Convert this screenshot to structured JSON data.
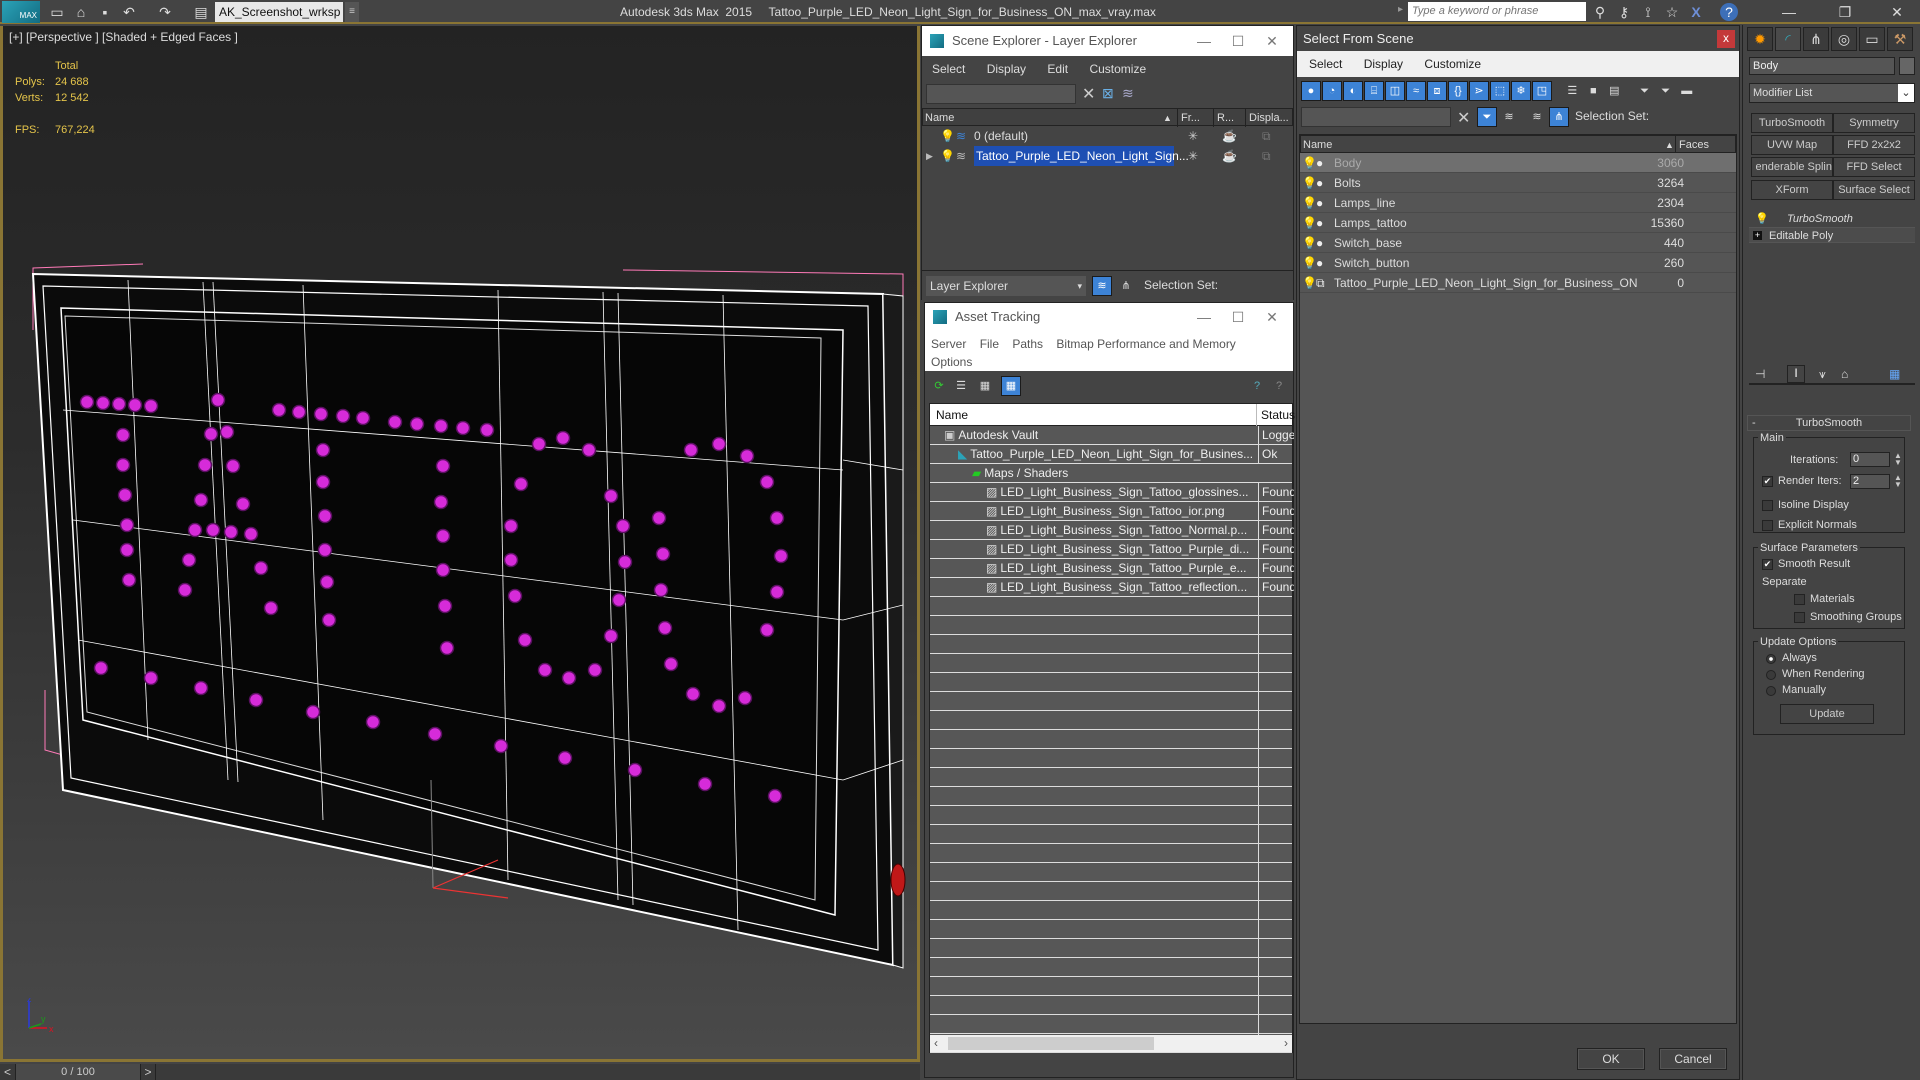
{
  "titlebar": {
    "logo": "MAX",
    "workspace": "AK_Screenshot_wrksp",
    "app_title": "Autodesk 3ds Max  2015     Tattoo_Purple_LED_Neon_Light_Sign_for_Business_ON_max_vray.max",
    "search_placeholder": "Type a keyword or phrase",
    "icons": [
      "new-file-icon",
      "open-file-icon",
      "save-icon",
      "undo-icon",
      "redo-icon",
      "project-folder-icon"
    ],
    "help_icons": [
      "binoculars-icon",
      "key-icon",
      "satellite-icon",
      "star-icon",
      "x-icon",
      "help-icon"
    ]
  },
  "viewport": {
    "label": "[+] [Perspective ] [Shaded + Edged Faces ]",
    "stats": {
      "total_label": "Total",
      "polys_label": "Polys:",
      "polys_value": "24 688",
      "verts_label": "Verts:",
      "verts_value": "12 542",
      "fps_label": "FPS:",
      "fps_value": "767,224"
    },
    "axis": {
      "x": "x",
      "y": "y",
      "z": "z"
    }
  },
  "timeline": {
    "prev": "<",
    "value": "0 / 100",
    "next": ">"
  },
  "scene_explorer": {
    "title": "Scene Explorer - Layer Explorer",
    "menu": [
      "Select",
      "Display",
      "Edit",
      "Customize"
    ],
    "columns": [
      "Name",
      "Fr...",
      "R...",
      "Displa..."
    ],
    "rows": [
      {
        "name": "0 (default)",
        "selected": false
      },
      {
        "name": "Tattoo_Purple_LED_Neon_Light_Sign...",
        "selected": true
      }
    ],
    "footer_dropdown": "Layer Explorer",
    "selection_set_label": "Selection Set:"
  },
  "asset_tracking": {
    "title": "Asset Tracking",
    "menu": [
      "Server",
      "File",
      "Paths",
      "Bitmap Performance and Memory",
      "Options"
    ],
    "columns": [
      "Name",
      "Status"
    ],
    "rows": [
      {
        "name": "Autodesk Vault",
        "status": "Logged",
        "indent": 1,
        "icon": "vault-icon"
      },
      {
        "name": "Tattoo_Purple_LED_Neon_Light_Sign_for_Busines...",
        "status": "Ok",
        "indent": 2,
        "icon": "max-file-icon"
      },
      {
        "name": "Maps / Shaders",
        "status": "",
        "indent": 3,
        "icon": "maps-icon"
      },
      {
        "name": "LED_Light_Business_Sign_Tattoo_glossines...",
        "status": "Found",
        "indent": 4,
        "icon": "bitmap-icon"
      },
      {
        "name": "LED_Light_Business_Sign_Tattoo_ior.png",
        "status": "Found",
        "indent": 4,
        "icon": "bitmap-icon"
      },
      {
        "name": "LED_Light_Business_Sign_Tattoo_Normal.p...",
        "status": "Found",
        "indent": 4,
        "icon": "bitmap-icon"
      },
      {
        "name": "LED_Light_Business_Sign_Tattoo_Purple_di...",
        "status": "Found",
        "indent": 4,
        "icon": "bitmap-icon"
      },
      {
        "name": "LED_Light_Business_Sign_Tattoo_Purple_e...",
        "status": "Found",
        "indent": 4,
        "icon": "bitmap-icon"
      },
      {
        "name": "LED_Light_Business_Sign_Tattoo_reflection...",
        "status": "Found",
        "indent": 4,
        "icon": "bitmap-icon"
      }
    ]
  },
  "select_from_scene": {
    "title": "Select From Scene",
    "close": "x",
    "menu": [
      "Select",
      "Display",
      "Customize"
    ],
    "selection_set_label": "Selection Set:",
    "columns": [
      "Name",
      "Faces"
    ],
    "rows": [
      {
        "name": "Body",
        "faces": "3060",
        "selected": true
      },
      {
        "name": "Bolts",
        "faces": "3264",
        "selected": false
      },
      {
        "name": "Lamps_line",
        "faces": "2304",
        "selected": false
      },
      {
        "name": "Lamps_tattoo",
        "faces": "15360",
        "selected": false
      },
      {
        "name": "Switch_base",
        "faces": "440",
        "selected": false
      },
      {
        "name": "Switch_button",
        "faces": "260",
        "selected": false
      },
      {
        "name": "Tattoo_Purple_LED_Neon_Light_Sign_for_Business_ON",
        "faces": "0",
        "selected": false
      }
    ],
    "ok": "OK",
    "cancel": "Cancel"
  },
  "command_panel": {
    "object_name": "Body",
    "modifier_list": "Modifier List",
    "modifier_buttons": [
      "TurboSmooth",
      "Symmetry",
      "UVW Map",
      "FFD 2x2x2",
      "enderable Splin",
      "FFD Select",
      "XForm",
      "Surface Select"
    ],
    "stack": [
      "TurboSmooth",
      "Editable Poly"
    ],
    "rollout_title": "TurboSmooth",
    "main_label": "Main",
    "iterations_label": "Iterations:",
    "iterations_value": "0",
    "render_iters_label": "Render Iters:",
    "render_iters_value": "2",
    "render_iters_checked": true,
    "isoline_label": "Isoline Display",
    "explicit_normals_label": "Explicit Normals",
    "surface_params_label": "Surface Parameters",
    "smooth_result_label": "Smooth Result",
    "smooth_result_checked": true,
    "separate_label": "Separate",
    "materials_label": "Materials",
    "smoothing_groups_label": "Smoothing Groups",
    "update_options_label": "Update Options",
    "update_options": [
      "Always",
      "When Rendering",
      "Manually"
    ],
    "update_selected": "Always",
    "update_button": "Update"
  }
}
